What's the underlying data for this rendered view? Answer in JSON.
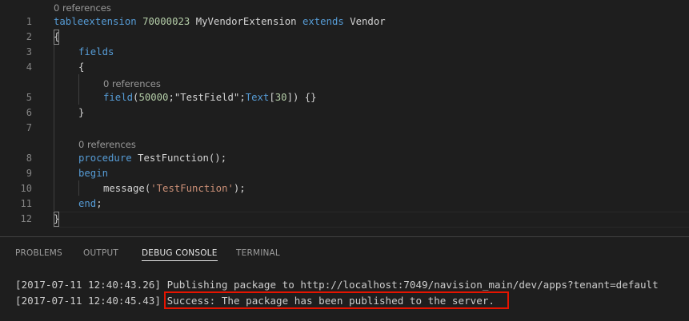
{
  "editor": {
    "line_numbers": [
      "1",
      "2",
      "3",
      "4",
      "5",
      "6",
      "7",
      "8",
      "9",
      "10",
      "11",
      "12"
    ],
    "code_lens": {
      "line1": "0 references",
      "line5": "0 references",
      "line8": "0 references"
    },
    "line1": {
      "kw": "tableextension",
      "id": "70000023",
      "name": "MyVendorExtension",
      "extends": "extends",
      "base": "Vendor"
    },
    "line2": "{",
    "line3": "fields",
    "line4": "{",
    "line5": {
      "fn": "field",
      "open": "(",
      "num": "50000",
      "sep1": ";",
      "str": "\"TestField\"",
      "sep2": ";",
      "type": "Text",
      "br_open": "[",
      "len": "30",
      "br_close": "])",
      "tail": " {}"
    },
    "line6": "}",
    "line8": {
      "kw": "procedure",
      "name": " TestFunction",
      "tail": "();"
    },
    "line9": "begin",
    "line10": {
      "fn": "message",
      "open": "(",
      "str": "'TestFunction'",
      "tail": ");"
    },
    "line11": {
      "kw": "end",
      "tail": ";"
    },
    "line12": "}"
  },
  "panel": {
    "tabs": [
      "PROBLEMS",
      "OUTPUT",
      "DEBUG CONSOLE",
      "TERMINAL"
    ],
    "active_tab": "DEBUG CONSOLE",
    "console": {
      "line1_time": "[2017-07-11 12:40:43.26]",
      "line1_msg": "Publishing package to http://localhost:7049/navision_main/dev/apps?tenant=default",
      "line2_time": "[2017-07-11 12:40:45.43]",
      "line2_msg": "Success: The package has been published to the server."
    }
  },
  "colors": {
    "background": "#1e1e1e",
    "keyword": "#569cd6",
    "number": "#b5cea8",
    "string": "#ce9178",
    "type": "#4ec9b0",
    "highlight_border": "#e51400"
  }
}
